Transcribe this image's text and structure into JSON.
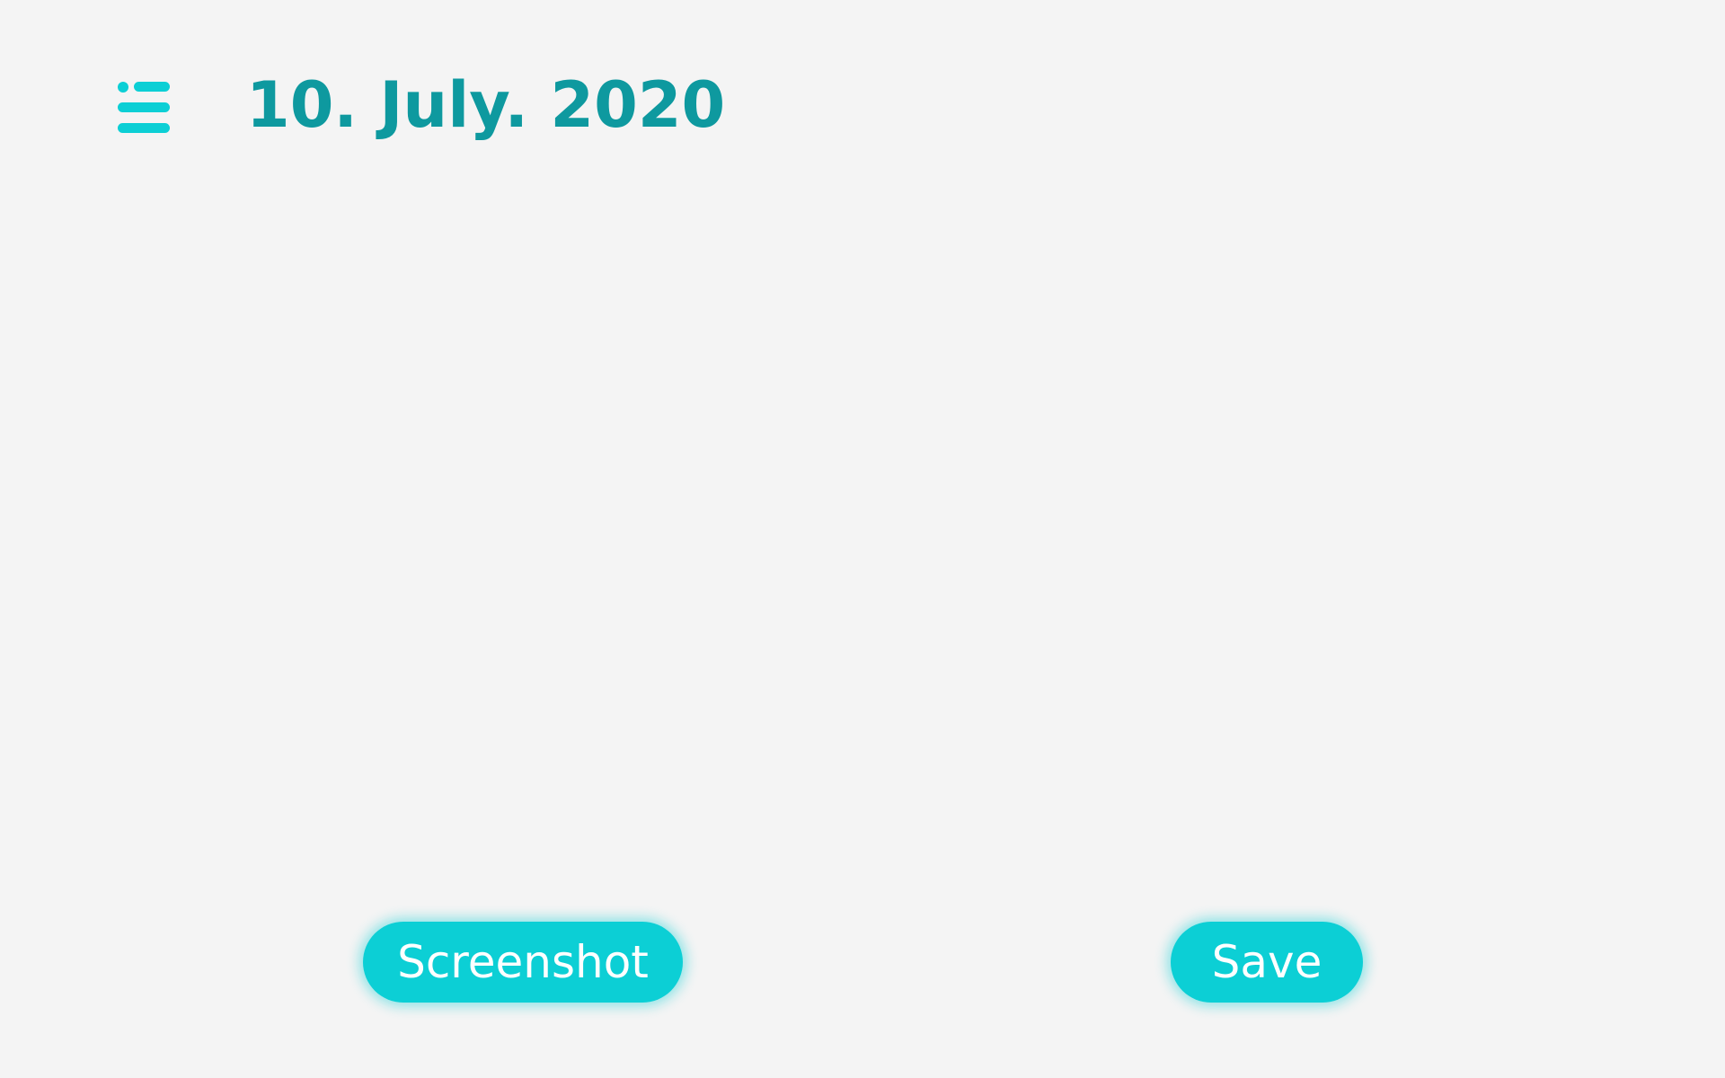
{
  "header": {
    "date": "10. July. 2020",
    "menu_icon": "hamburger-menu-icon"
  },
  "actions": {
    "screenshot_label": "Screenshot",
    "save_label": "Save"
  },
  "colors": {
    "background": "#f4f4f4",
    "title": "#0e999f",
    "accent": "#0ccfd5",
    "button_text": "#ffffff"
  }
}
